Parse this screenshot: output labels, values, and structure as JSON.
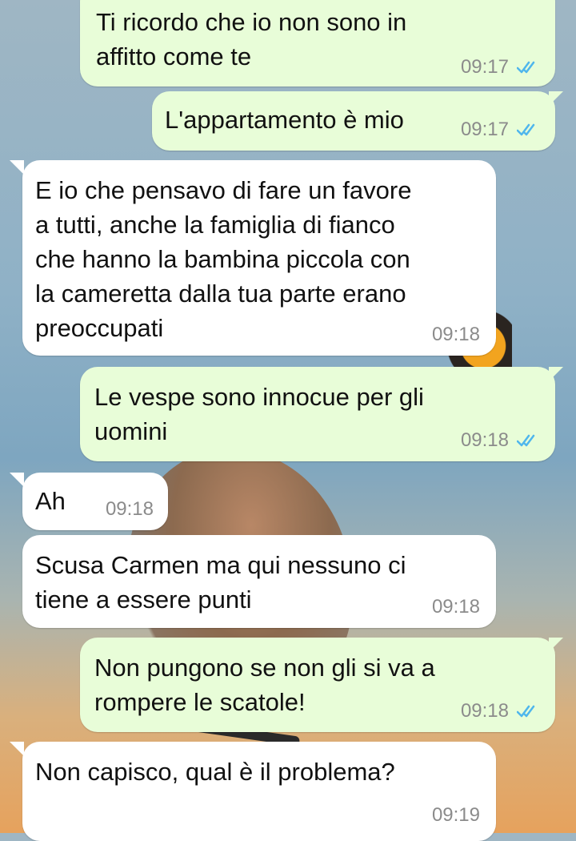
{
  "messages": [
    {
      "dir": "out",
      "text": "Ti ricordo che io non sono in\naffitto come te",
      "time": "09:17",
      "read": true
    },
    {
      "dir": "out",
      "text": "L'appartamento è mio",
      "time": "09:17",
      "read": true
    },
    {
      "dir": "in",
      "text": "E io che pensavo di fare un favore\na tutti, anche la famiglia di fianco\nche hanno la bambina piccola con\nla cameretta dalla tua parte erano\npreoccupati",
      "time": "09:18"
    },
    {
      "dir": "out",
      "text": "Le vespe sono innocue per gli\nuomini",
      "time": "09:18",
      "read": true
    },
    {
      "dir": "in",
      "text": "Ah",
      "time": "09:18"
    },
    {
      "dir": "in",
      "text": "Scusa Carmen ma qui nessuno ci\ntiene a essere punti",
      "time": "09:18"
    },
    {
      "dir": "out",
      "text": "Non pungono se non gli si va a\nrompere le scatole!",
      "time": "09:18",
      "read": true
    },
    {
      "dir": "in",
      "text": "Non capisco, qual è il problema?",
      "time": "09:19"
    }
  ],
  "colors": {
    "outgoing_bubble": "#e8fdd8",
    "incoming_bubble": "#ffffff",
    "read_ticks": "#4fb6ec",
    "time_text": "#8b8b8b"
  },
  "icons": {
    "read_receipt": "double-check-icon"
  }
}
